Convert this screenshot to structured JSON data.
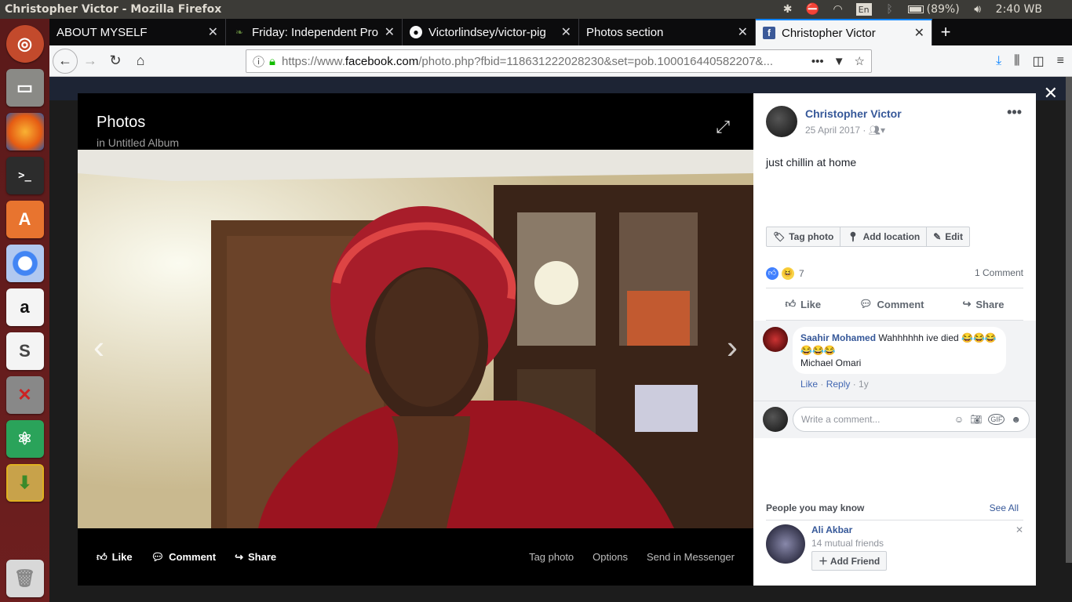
{
  "window_title": "Christopher Victor - Mozilla Firefox",
  "tray": {
    "keyboard": "En",
    "battery": "(89%)",
    "clock": "2:40 WB"
  },
  "tabs": [
    {
      "label": "ABOUT MYSELF",
      "icon": "blank-page-icon"
    },
    {
      "label": "Friday: Independent Pro",
      "icon": "leaf-icon"
    },
    {
      "label": "Victorlindsey/victor-pig",
      "icon": "github-icon"
    },
    {
      "label": "Photos section",
      "icon": "blank-page-icon"
    },
    {
      "label": "Christopher Victor",
      "icon": "facebook-icon",
      "active": true
    }
  ],
  "url": {
    "prefix": "https://www.",
    "domain": "facebook.com",
    "rest": "/photo.php?fbid=118631222028230&set=pob.100016440582207&..."
  },
  "viewer": {
    "title": "Photos",
    "subtitle": "in Untitled Album",
    "like": "Like",
    "comment": "Comment",
    "share": "Share",
    "tag_photo": "Tag photo",
    "options": "Options",
    "send": "Send in Messenger"
  },
  "post": {
    "author": "Christopher Victor",
    "date": "25 April 2017 ·",
    "caption": "just chillin at home",
    "tag_photo": "Tag photo",
    "add_location": "Add location",
    "edit": "Edit",
    "reaction_count": "7",
    "comment_count": "1 Comment",
    "like": "Like",
    "comment": "Comment",
    "share": "Share"
  },
  "comment": {
    "author": "Saahir Mohamed",
    "text": "Wahhhhhh ive died 😂😂😂😂😂😂",
    "mention": "Michael Omari",
    "like": "Like",
    "reply": "Reply",
    "age": "1y"
  },
  "write_comment": {
    "placeholder": "Write a comment..."
  },
  "pymk": {
    "heading": "People you may know",
    "see_all": "See All",
    "name": "Ali Akbar",
    "mutual": "14 mutual friends",
    "add_friend": "Add Friend"
  },
  "colors": {
    "facebook_blue": "#365899",
    "launcher_red": "#6e1f1f",
    "accent": "#0a84ff"
  }
}
